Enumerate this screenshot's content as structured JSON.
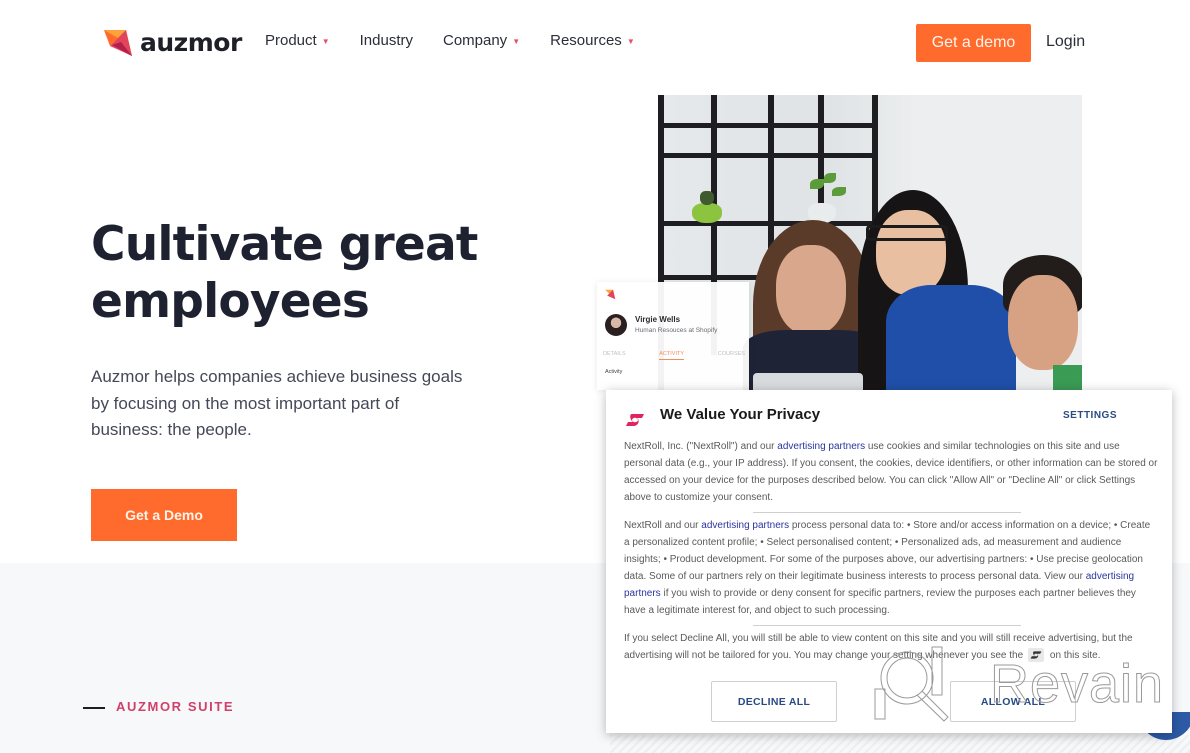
{
  "nav": {
    "brand": "auzmor",
    "logo_icon": "auzmor-logo-icon",
    "links": [
      {
        "label": "Product",
        "has_dropdown": true
      },
      {
        "label": "Industry",
        "has_dropdown": false
      },
      {
        "label": "Company",
        "has_dropdown": true
      },
      {
        "label": "Resources",
        "has_dropdown": true
      }
    ],
    "caret_glyph": "▼",
    "cta_label": "Get a demo",
    "login_label": "Login"
  },
  "hero": {
    "title_line1": "Cultivate great",
    "title_line2": "employees",
    "description": "Auzmor helps companies achieve business goals by focusing on the most important part of business: the people.",
    "cta_label": "Get a Demo"
  },
  "profile_card": {
    "name": "Virgie Wells",
    "role": "Human Resouces at Shopify",
    "tabs": [
      "DETAILS",
      "ACTIVITY",
      "COURSES"
    ],
    "active_tab": "ACTIVITY",
    "section_label": "Activity"
  },
  "suite": {
    "label": "AUZMOR SUITE"
  },
  "privacy": {
    "title": "We Value Your Privacy",
    "settings_label": "SETTINGS",
    "p1_before": "NextRoll, Inc. (\"NextRoll\") and our ",
    "p1_link": "advertising partners",
    "p1_after": " use cookies and similar technologies on this site and use personal data (e.g., your IP address). If you consent, the cookies, device identifiers, or other information can be stored or accessed on your device for the purposes described below. You can click \"Allow All\" or \"Decline All\" or click Settings above to customize your consent.",
    "p2_before": "NextRoll and our ",
    "p2_link1": "advertising partners",
    "p2_middle": " process personal data to: • Store and/or access information on a device; • Create a personalized content profile; • Select personalised content; • Personalized ads, ad measurement and audience insights; • Product development. For some of the purposes above, our advertising partners: • Use precise geolocation data. Some of our partners rely on their legitimate business interests to process personal data. View our ",
    "p2_link2": "advertising partners",
    "p2_after": " if you wish to provide or deny consent for specific partners, review the purposes each partner believes they have a legitimate interest for, and object to such processing.",
    "p3_before": "If you select Decline All, you will still be able to view content on this site and you will still receive advertising, but the advertising will not be tailored for you. You may change your setting whenever you see the",
    "p3_after": "on this site.",
    "decline_label": "DECLINE ALL",
    "allow_label": "ALLOW ALL",
    "brand_color": "#e0245e",
    "link_color": "#2a35a0"
  },
  "watermark": {
    "text": "Revain"
  },
  "colors": {
    "accent_orange": "#ff6b2c",
    "suite_pink": "#d0406a",
    "heading_dark": "#1e2230"
  }
}
